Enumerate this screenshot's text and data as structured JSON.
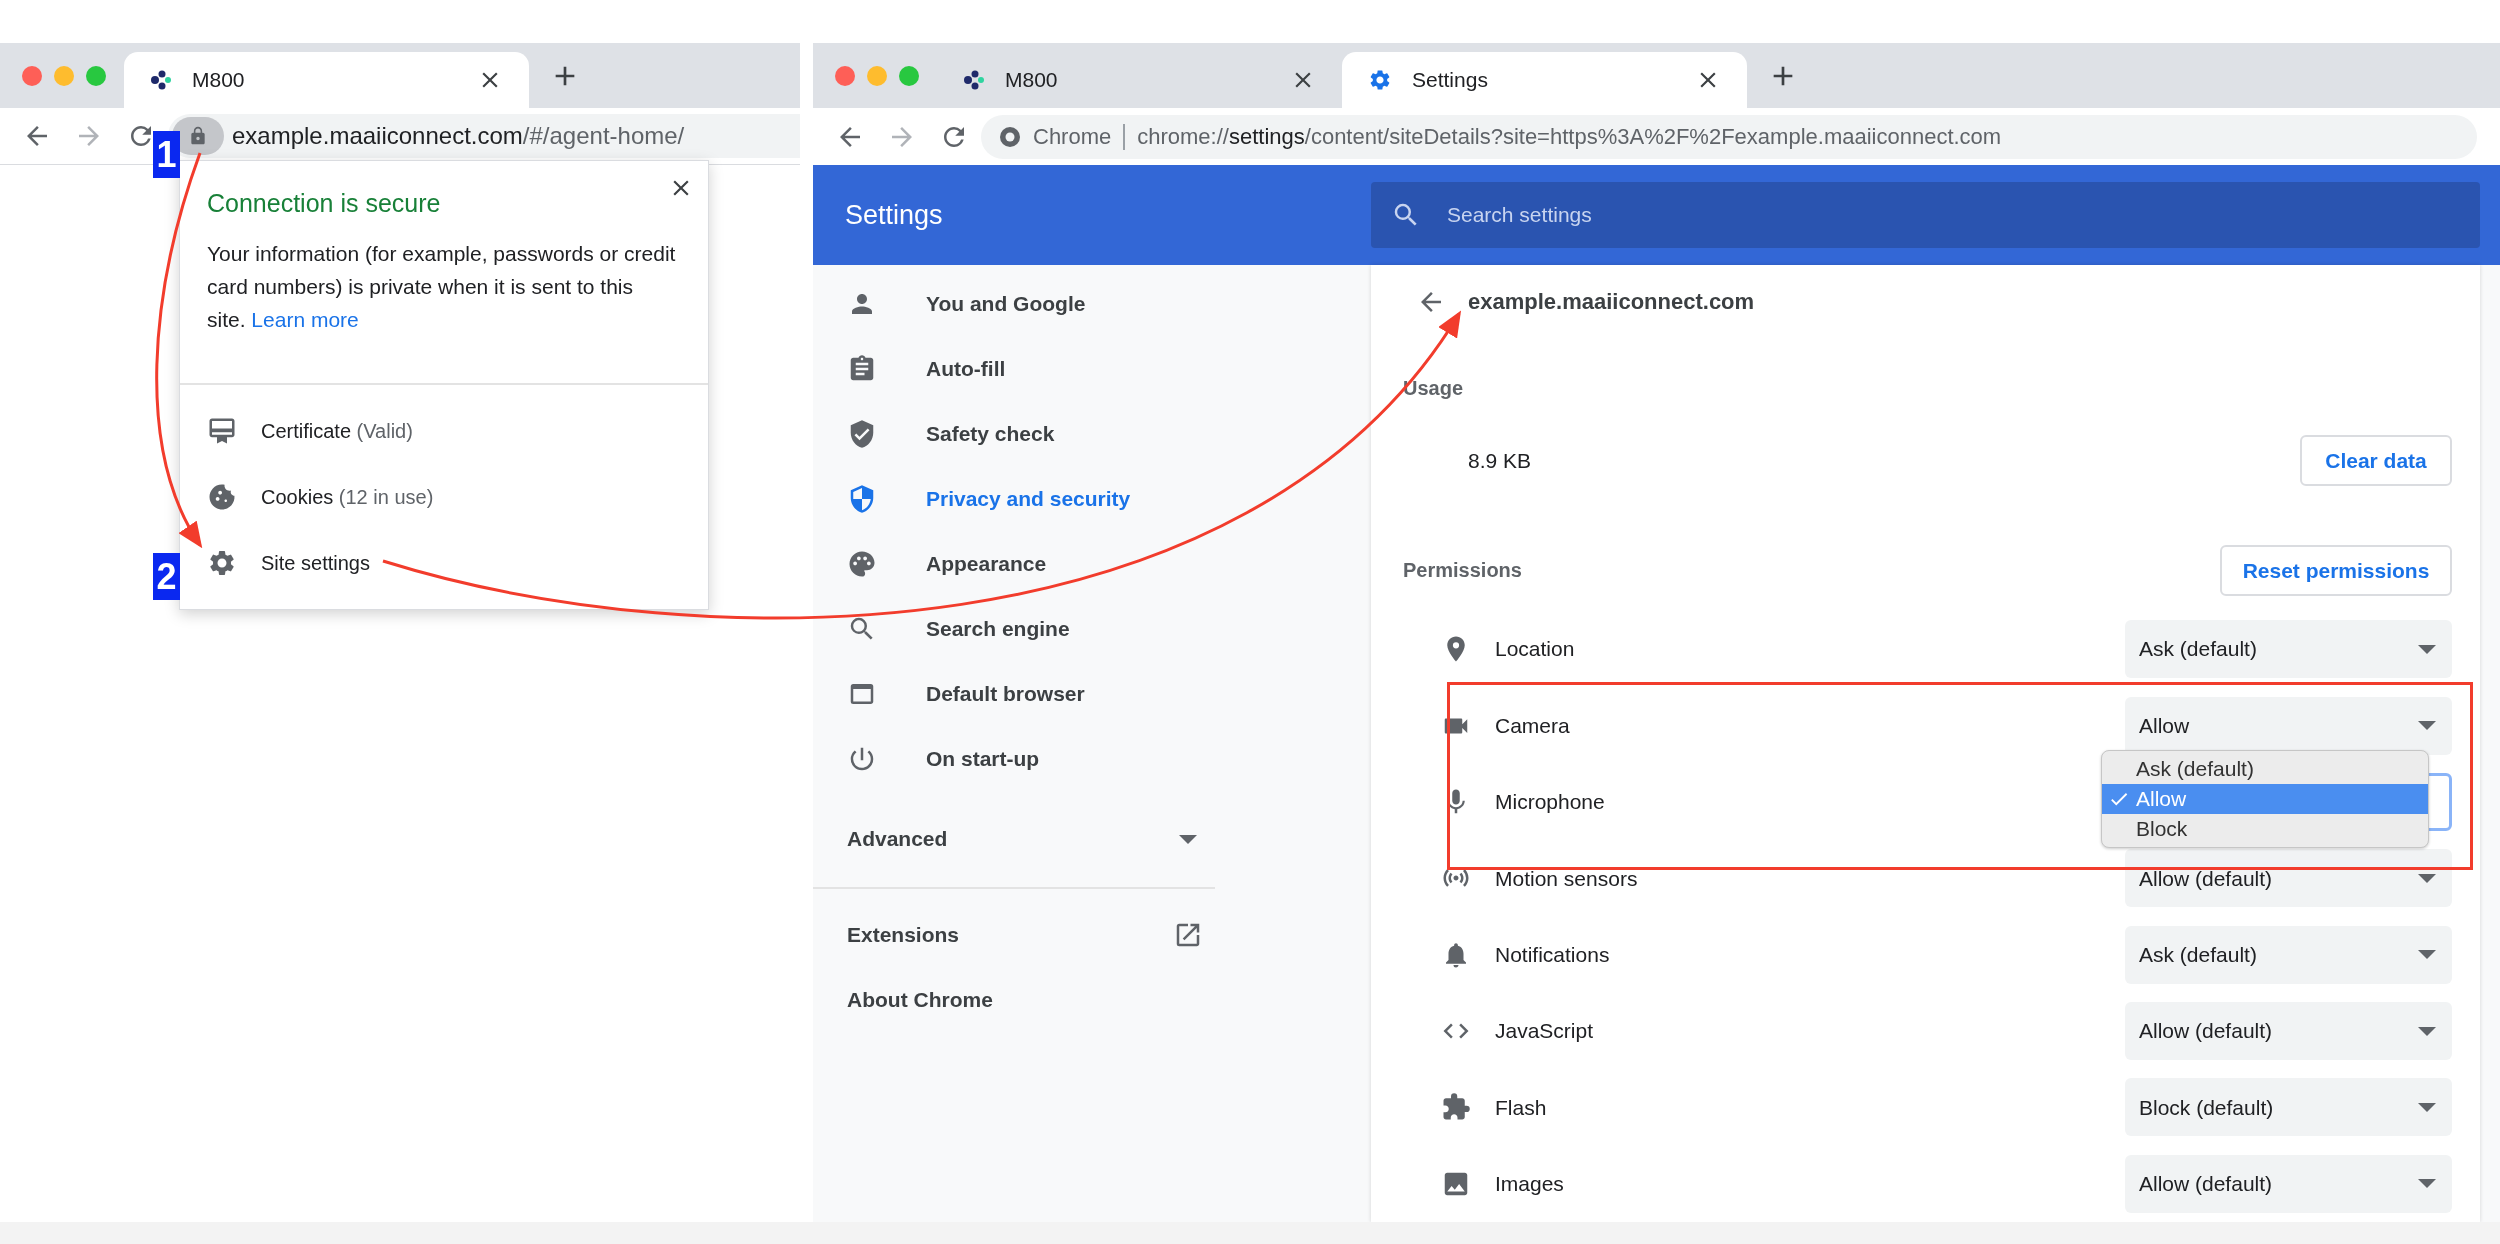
{
  "left_window": {
    "tabs": [
      {
        "title": "M800",
        "selected": true
      }
    ],
    "address_bar": {
      "host": "example.maaiiconnect.com",
      "path": "/#/agent-home/"
    },
    "site_info_popup": {
      "title": "Connection is secure",
      "body": "Your information (for example, passwords or credit card numbers) is private when it is sent to this site.",
      "link": "Learn more",
      "items": [
        {
          "label": "Certificate",
          "note": "(Valid)"
        },
        {
          "label": "Cookies",
          "note": "(12 in use)"
        },
        {
          "label": "Site settings"
        }
      ]
    }
  },
  "right_window": {
    "tabs": [
      {
        "title": "M800",
        "selected": false
      },
      {
        "title": "Settings",
        "selected": true
      }
    ],
    "address_bar": {
      "chip": "Chrome",
      "scheme": "chrome://",
      "host": "settings",
      "path": "/content/siteDetails?site=https%3A%2F%2Fexample.maaiiconnect.com"
    },
    "header": {
      "title": "Settings",
      "search_placeholder": "Search settings"
    },
    "sidebar": {
      "items": [
        {
          "label": "You and Google",
          "selected": false
        },
        {
          "label": "Auto-fill",
          "selected": false
        },
        {
          "label": "Safety check",
          "selected": false
        },
        {
          "label": "Privacy and security",
          "selected": true
        },
        {
          "label": "Appearance",
          "selected": false
        },
        {
          "label": "Search engine",
          "selected": false
        },
        {
          "label": "Default browser",
          "selected": false
        },
        {
          "label": "On start-up",
          "selected": false
        }
      ],
      "advanced": "Advanced",
      "links": [
        {
          "label": "Extensions",
          "external": true
        },
        {
          "label": "About Chrome",
          "external": false
        }
      ]
    },
    "site_details": {
      "site": "example.maaiiconnect.com",
      "usage_heading": "Usage",
      "usage": "8.9 KB",
      "clear_button": "Clear data",
      "permissions_heading": "Permissions",
      "reset_button": "Reset permissions",
      "permissions": [
        {
          "name": "Location",
          "value": "Ask (default)"
        },
        {
          "name": "Camera",
          "value": "Allow"
        },
        {
          "name": "Microphone",
          "menu": [
            {
              "label": "Ask (default)",
              "selected": false
            },
            {
              "label": "Allow",
              "selected": true
            },
            {
              "label": "Block",
              "selected": false
            }
          ]
        },
        {
          "name": "Motion sensors",
          "value": "Allow (default)"
        },
        {
          "name": "Notifications",
          "value": "Ask (default)"
        },
        {
          "name": "JavaScript",
          "value": "Allow (default)"
        },
        {
          "name": "Flash",
          "value": "Block (default)"
        },
        {
          "name": "Images",
          "value": "Allow (default)"
        }
      ]
    }
  },
  "annotations": {
    "steps": [
      "1",
      "2"
    ]
  }
}
